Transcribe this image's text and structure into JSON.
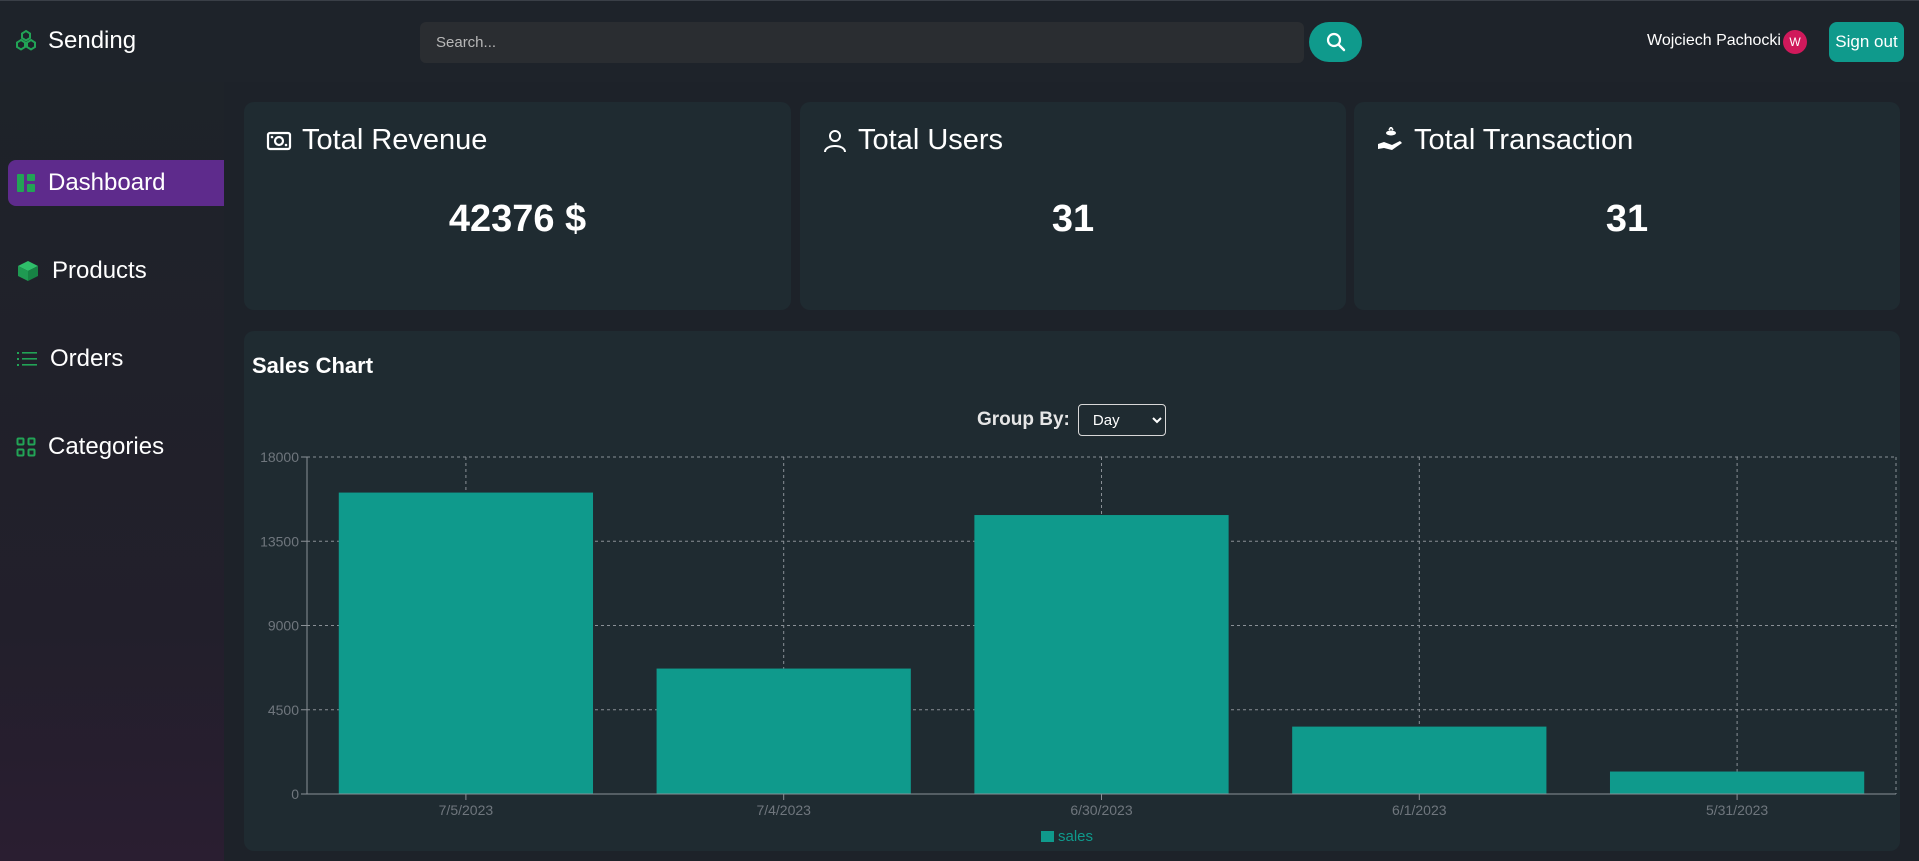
{
  "app": {
    "brand": "Sending",
    "brand_icon": "hexagon-cluster-icon"
  },
  "search": {
    "placeholder": "Search..."
  },
  "user": {
    "name": "Wojciech Pachocki",
    "avatar_initial": "W"
  },
  "header": {
    "signout_label": "Sign out"
  },
  "colors": {
    "accent": "#0f9a8c",
    "active_nav": "#5e2b8c",
    "avatar": "#d0195b",
    "card": "#1f2b31",
    "nav_icon": "#22a356"
  },
  "sidebar": {
    "items": [
      {
        "label": "Dashboard",
        "icon": "dashboard-icon",
        "active": true
      },
      {
        "label": "Products",
        "icon": "cube-icon",
        "active": false
      },
      {
        "label": "Orders",
        "icon": "list-icon",
        "active": false
      },
      {
        "label": "Categories",
        "icon": "grid-icon",
        "active": false
      }
    ]
  },
  "cards": [
    {
      "title": "Total Revenue",
      "value": "42376 $",
      "icon": "money-icon"
    },
    {
      "title": "Total Users",
      "value": "31",
      "icon": "user-icon"
    },
    {
      "title": "Total Transaction",
      "value": "31",
      "icon": "hand-coin-icon"
    }
  ],
  "sales": {
    "title": "Sales Chart",
    "group_by_label": "Group By:",
    "group_by_value": "Day",
    "group_by_options": [
      "Day"
    ]
  },
  "chart_data": {
    "type": "bar",
    "categories": [
      "7/5/2023",
      "7/4/2023",
      "6/30/2023",
      "6/1/2023",
      "5/31/2023"
    ],
    "series": [
      {
        "name": "sales",
        "values": [
          16100,
          6700,
          14900,
          3600,
          1200
        ],
        "color": "#0f9a8c"
      }
    ],
    "yticks": [
      0,
      4500,
      9000,
      13500,
      18000
    ],
    "ylim": [
      0,
      18000
    ],
    "grid": true,
    "legend": "bottom-center"
  }
}
